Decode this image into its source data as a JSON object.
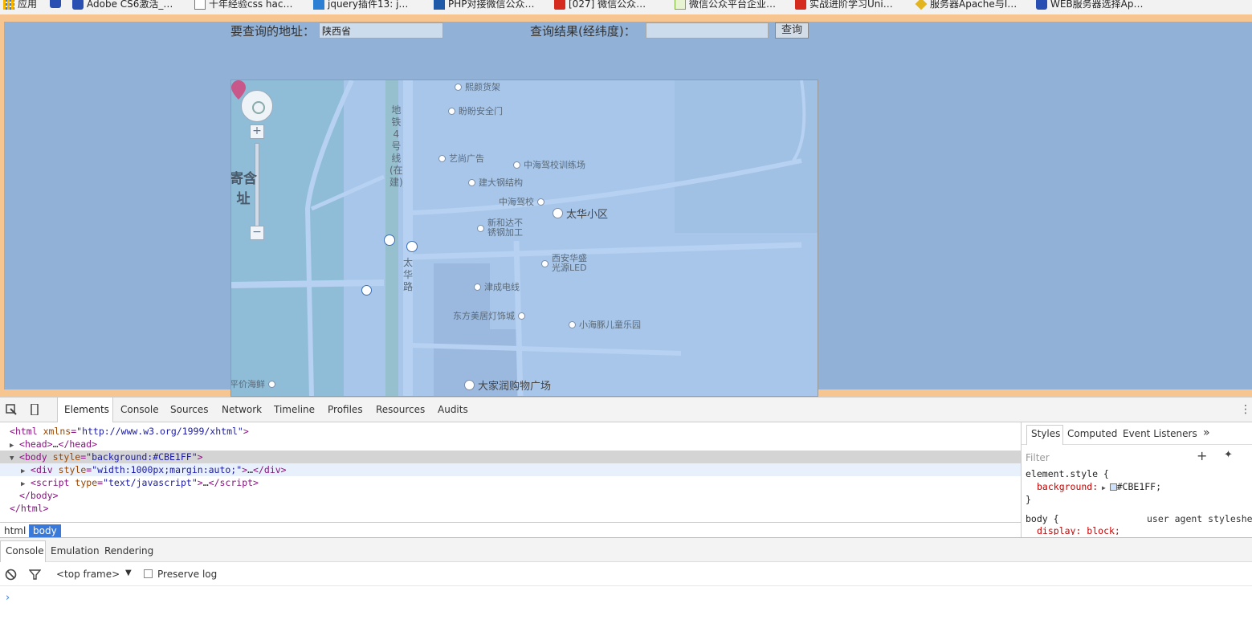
{
  "bookmarks": [
    {
      "label": "应用",
      "icon": "apps-grid-icon"
    },
    {
      "label": "Adobe CS6激活_…",
      "icon": "paw-icon"
    },
    {
      "label": "十年经验css hac…",
      "icon": "document-icon"
    },
    {
      "label": "jquery插件13: j…",
      "icon": "blue-square-icon"
    },
    {
      "label": "PHP对接微信公众…",
      "icon": "s-logo-icon"
    },
    {
      "label": "[027] 微信公众…",
      "icon": "c-logo-icon"
    },
    {
      "label": "微信公众平台企业…",
      "icon": "green-logo-icon"
    },
    {
      "label": "实战进阶学习Uni…",
      "icon": "c-logo-icon"
    },
    {
      "label": "服务器Apache与I…",
      "icon": "diamond-icon"
    },
    {
      "label": "WEB服务器选择Ap…",
      "icon": "paw-icon"
    }
  ],
  "page": {
    "address_label": "要查询的地址：",
    "address_value": "陕西省",
    "result_label": "查询结果(经纬度)：",
    "result_value": "",
    "query_button": "查询"
  },
  "map": {
    "pois": [
      {
        "label": "熙颜货架"
      },
      {
        "label": "盼盼安全门"
      },
      {
        "label": "艺尚广告"
      },
      {
        "label": "中海驾校训练场"
      },
      {
        "label": "建大钢结构"
      },
      {
        "label": "中海驾校"
      },
      {
        "label": "太华小区"
      },
      {
        "label": "新和达不"
      },
      {
        "label": "锈钢加工"
      },
      {
        "label": "西安华盛"
      },
      {
        "label": "光源LED"
      },
      {
        "label": "津成电线"
      },
      {
        "label": "东方美居灯饰城"
      },
      {
        "label": "小海豚儿童乐园"
      },
      {
        "label": "大家润购物广场"
      },
      {
        "label": "平价海鲜"
      }
    ],
    "metro_label": "地铁4号线(在建)",
    "road_label": "太华路",
    "side_label_1": "寄含",
    "side_label_2": "址",
    "zoom_in": "+",
    "zoom_out": "−"
  },
  "devtools": {
    "tabs": [
      "Elements",
      "Console",
      "Sources",
      "Network",
      "Timeline",
      "Profiles",
      "Resources",
      "Audits"
    ],
    "active_tab": "Elements",
    "dom": {
      "html_open_tag": "html",
      "html_attr": "xmlns",
      "html_attr_val": "\"http://www.w3.org/1999/xhtml\"",
      "head": "head",
      "head_ellipsis": "…",
      "body_tag": "body",
      "body_attr": "style",
      "body_attr_val": "\"background:#CBE1FF\"",
      "div_tag": "div",
      "div_attr": "style",
      "div_attr_val": "\"width:1000px;margin:auto;\"",
      "div_ellipsis": "…",
      "script_tag": "script",
      "script_attr": "type",
      "script_attr_val": "\"text/javascript\"",
      "script_ellipsis": "…",
      "body_close": "body",
      "html_close": "html"
    },
    "breadcrumbs": [
      "html",
      "body"
    ],
    "styles_tabs": [
      "Styles",
      "Computed",
      "Event Listeners"
    ],
    "styles": {
      "filter_placeholder": "Filter",
      "rule1_selector": "element.style {",
      "rule1_prop": "background:",
      "rule1_value": "#CBE1FF;",
      "rule1_close": "}",
      "rule2_selector": "body {",
      "rule2_source": "user agent styleshe",
      "rule2_prop": "display: block;"
    },
    "drawer_tabs": [
      "Console",
      "Emulation",
      "Rendering"
    ],
    "frame_select": "<top frame>",
    "preserve_log": "Preserve log"
  }
}
